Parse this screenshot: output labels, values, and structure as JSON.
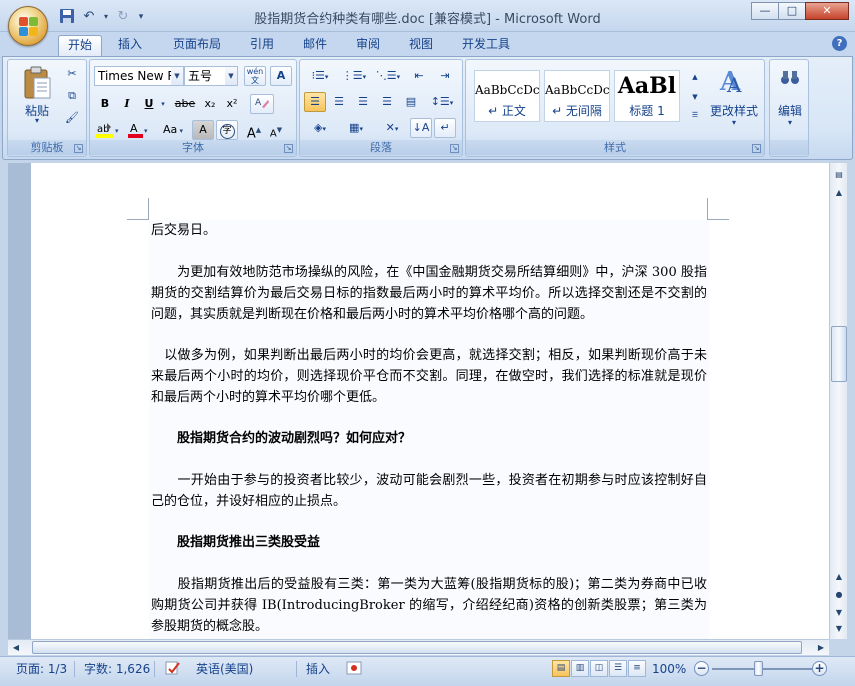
{
  "window": {
    "title": "股指期货合约种类有哪些.doc [兼容模式] - Microsoft Word",
    "minimize": "—",
    "maximize": "□",
    "close": "✕"
  },
  "tabs": [
    "开始",
    "插入",
    "页面布局",
    "引用",
    "邮件",
    "审阅",
    "视图",
    "开发工具"
  ],
  "ribbon": {
    "clipboard": {
      "label": "剪贴板",
      "paste": "粘贴"
    },
    "font": {
      "label": "字体",
      "font_name": "Times New R",
      "font_size": "五号",
      "wen": "wén",
      "a_box": "A",
      "bold": "B",
      "italic": "I",
      "underline": "U",
      "strike": "abe",
      "subscript": "x₂",
      "superscript": "x²",
      "case": "Aa",
      "grow": "A",
      "shrink": "A",
      "shade_a": "A",
      "circle": "字"
    },
    "paragraph": {
      "label": "段落"
    },
    "styles": {
      "label": "样式",
      "tiles": [
        {
          "sample": "AaBbCcDc",
          "name": "↵ 正文"
        },
        {
          "sample": "AaBbCcDc",
          "name": "↵ 无间隔"
        },
        {
          "sample": "AaBl",
          "name": "标题 1"
        }
      ],
      "change_styles": "更改样式"
    },
    "editing": {
      "label": "编辑"
    }
  },
  "document": {
    "paragraphs": [
      {
        "type": "text",
        "text": "后交易日。"
      },
      {
        "type": "text",
        "text": "　　为更加有效地防范市场操纵的风险，在《中国金融期货交易所结算细则》中，沪深 300 股指期货的交割结算价为最后交易日标的指数最后两小时的算术平均价。所以选择交割还是不交割的问题，其实质就是判断现在价格和最后两小时的算术平均价格哪个高的问题。"
      },
      {
        "type": "text",
        "text": "　以做多为例，如果判断出最后两小时的均价会更高，就选择交割；相反，如果判断现价高于未来最后两个小时的均价，则选择现价平仓而不交割。同理，在做空时，我们选择的标准就是现价和最后两个小时的算术平均价哪个更低。"
      },
      {
        "type": "heading",
        "text": "　　股指期货合约的波动剧烈吗？如何应对？"
      },
      {
        "type": "text",
        "text": "　　一开始由于参与的投资者比较少，波动可能会剧烈一些，投资者在初期参与时应该控制好自己的仓位，并设好相应的止损点。"
      },
      {
        "type": "heading",
        "text": "　　股指期货推出三类股受益"
      },
      {
        "type": "text",
        "text": "　　股指期货推出后的受益股有三类：第一类为大蓝筹(股指期货标的股)；第二类为券商中已收购期货公司并获得 IB(IntroducingBroker 的缩写，介绍经纪商)资格的创新类股票；第三类为参股期货的概念股。"
      }
    ]
  },
  "status": {
    "page": "页面: 1/3",
    "words": "字数: 1,626",
    "language": "英语(美国)",
    "mode": "插入",
    "zoom": "100%",
    "zoom_minus": "−",
    "zoom_plus": "+"
  }
}
